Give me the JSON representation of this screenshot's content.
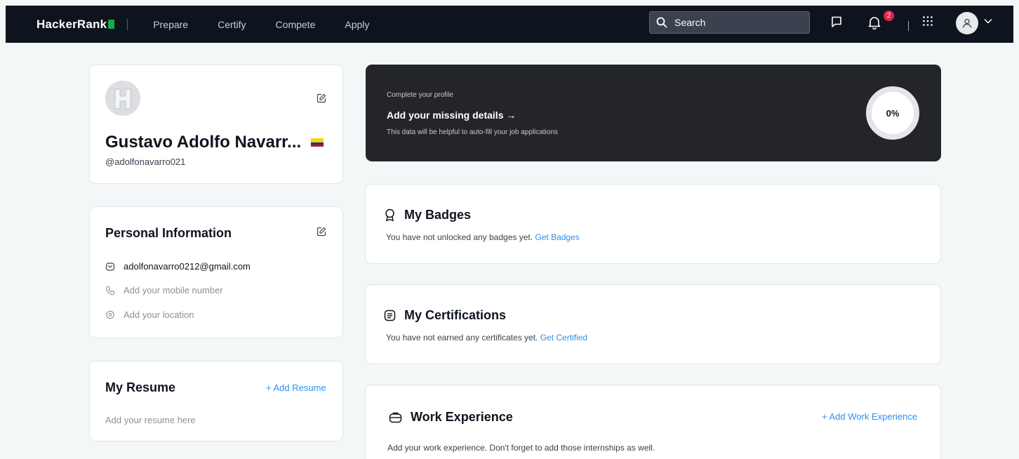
{
  "nav": {
    "logo": "HackerRank",
    "links": [
      "Prepare",
      "Certify",
      "Compete",
      "Apply"
    ],
    "search_placeholder": "Search",
    "notification_count": "2",
    "icons": [
      "search-icon",
      "chat-icon",
      "bell-icon",
      "apps-grid-icon",
      "user-icon",
      "chevron-down-icon"
    ]
  },
  "profile": {
    "name": "Gustavo Adolfo Navarr...",
    "handle": "@adolfonavarro021",
    "flag": "Colombia"
  },
  "personal_info": {
    "heading": "Personal Information",
    "email": "adolfonavarro0212@gmail.com",
    "mobile_placeholder": "Add your mobile number",
    "location_placeholder": "Add your location"
  },
  "resume": {
    "heading": "My Resume",
    "add_link": "+ Add Resume",
    "placeholder": "Add your resume here"
  },
  "completion": {
    "eyebrow": "Complete your profile",
    "title": "Add your missing details →",
    "subtitle": "This data will be helpful to auto-fill your job applications",
    "percent": "0%"
  },
  "badges": {
    "heading": "My Badges",
    "text": "You have not unlocked any badges yet.",
    "link": "Get Badges"
  },
  "certifications": {
    "heading": "My Certifications",
    "text": "You have not earned any certificates yet.",
    "link": "Get Certified"
  },
  "work": {
    "heading": "Work Experience",
    "add_link": "+ Add Work Experience",
    "text": "Add your work experience. Don't forget to add those internships as well."
  },
  "colors": {
    "nav_bg": "#0e141e",
    "brand_green": "#1ba94c",
    "link_blue": "#2f8ff1",
    "dark_card": "#242529",
    "badge_red": "#e0234b"
  }
}
